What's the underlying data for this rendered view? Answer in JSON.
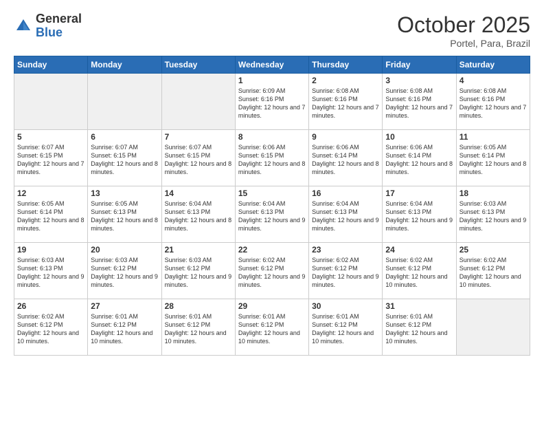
{
  "logo": {
    "general": "General",
    "blue": "Blue"
  },
  "title": "October 2025",
  "subtitle": "Portel, Para, Brazil",
  "days_header": [
    "Sunday",
    "Monday",
    "Tuesday",
    "Wednesday",
    "Thursday",
    "Friday",
    "Saturday"
  ],
  "weeks": [
    [
      {
        "day": "",
        "info": ""
      },
      {
        "day": "",
        "info": ""
      },
      {
        "day": "",
        "info": ""
      },
      {
        "day": "1",
        "info": "Sunrise: 6:09 AM\nSunset: 6:16 PM\nDaylight: 12 hours\nand 7 minutes."
      },
      {
        "day": "2",
        "info": "Sunrise: 6:08 AM\nSunset: 6:16 PM\nDaylight: 12 hours\nand 7 minutes."
      },
      {
        "day": "3",
        "info": "Sunrise: 6:08 AM\nSunset: 6:16 PM\nDaylight: 12 hours\nand 7 minutes."
      },
      {
        "day": "4",
        "info": "Sunrise: 6:08 AM\nSunset: 6:16 PM\nDaylight: 12 hours\nand 7 minutes."
      }
    ],
    [
      {
        "day": "5",
        "info": "Sunrise: 6:07 AM\nSunset: 6:15 PM\nDaylight: 12 hours\nand 7 minutes."
      },
      {
        "day": "6",
        "info": "Sunrise: 6:07 AM\nSunset: 6:15 PM\nDaylight: 12 hours\nand 8 minutes."
      },
      {
        "day": "7",
        "info": "Sunrise: 6:07 AM\nSunset: 6:15 PM\nDaylight: 12 hours\nand 8 minutes."
      },
      {
        "day": "8",
        "info": "Sunrise: 6:06 AM\nSunset: 6:15 PM\nDaylight: 12 hours\nand 8 minutes."
      },
      {
        "day": "9",
        "info": "Sunrise: 6:06 AM\nSunset: 6:14 PM\nDaylight: 12 hours\nand 8 minutes."
      },
      {
        "day": "10",
        "info": "Sunrise: 6:06 AM\nSunset: 6:14 PM\nDaylight: 12 hours\nand 8 minutes."
      },
      {
        "day": "11",
        "info": "Sunrise: 6:05 AM\nSunset: 6:14 PM\nDaylight: 12 hours\nand 8 minutes."
      }
    ],
    [
      {
        "day": "12",
        "info": "Sunrise: 6:05 AM\nSunset: 6:14 PM\nDaylight: 12 hours\nand 8 minutes."
      },
      {
        "day": "13",
        "info": "Sunrise: 6:05 AM\nSunset: 6:13 PM\nDaylight: 12 hours\nand 8 minutes."
      },
      {
        "day": "14",
        "info": "Sunrise: 6:04 AM\nSunset: 6:13 PM\nDaylight: 12 hours\nand 8 minutes."
      },
      {
        "day": "15",
        "info": "Sunrise: 6:04 AM\nSunset: 6:13 PM\nDaylight: 12 hours\nand 9 minutes."
      },
      {
        "day": "16",
        "info": "Sunrise: 6:04 AM\nSunset: 6:13 PM\nDaylight: 12 hours\nand 9 minutes."
      },
      {
        "day": "17",
        "info": "Sunrise: 6:04 AM\nSunset: 6:13 PM\nDaylight: 12 hours\nand 9 minutes."
      },
      {
        "day": "18",
        "info": "Sunrise: 6:03 AM\nSunset: 6:13 PM\nDaylight: 12 hours\nand 9 minutes."
      }
    ],
    [
      {
        "day": "19",
        "info": "Sunrise: 6:03 AM\nSunset: 6:13 PM\nDaylight: 12 hours\nand 9 minutes."
      },
      {
        "day": "20",
        "info": "Sunrise: 6:03 AM\nSunset: 6:12 PM\nDaylight: 12 hours\nand 9 minutes."
      },
      {
        "day": "21",
        "info": "Sunrise: 6:03 AM\nSunset: 6:12 PM\nDaylight: 12 hours\nand 9 minutes."
      },
      {
        "day": "22",
        "info": "Sunrise: 6:02 AM\nSunset: 6:12 PM\nDaylight: 12 hours\nand 9 minutes."
      },
      {
        "day": "23",
        "info": "Sunrise: 6:02 AM\nSunset: 6:12 PM\nDaylight: 12 hours\nand 9 minutes."
      },
      {
        "day": "24",
        "info": "Sunrise: 6:02 AM\nSunset: 6:12 PM\nDaylight: 12 hours\nand 10 minutes."
      },
      {
        "day": "25",
        "info": "Sunrise: 6:02 AM\nSunset: 6:12 PM\nDaylight: 12 hours\nand 10 minutes."
      }
    ],
    [
      {
        "day": "26",
        "info": "Sunrise: 6:02 AM\nSunset: 6:12 PM\nDaylight: 12 hours\nand 10 minutes."
      },
      {
        "day": "27",
        "info": "Sunrise: 6:01 AM\nSunset: 6:12 PM\nDaylight: 12 hours\nand 10 minutes."
      },
      {
        "day": "28",
        "info": "Sunrise: 6:01 AM\nSunset: 6:12 PM\nDaylight: 12 hours\nand 10 minutes."
      },
      {
        "day": "29",
        "info": "Sunrise: 6:01 AM\nSunset: 6:12 PM\nDaylight: 12 hours\nand 10 minutes."
      },
      {
        "day": "30",
        "info": "Sunrise: 6:01 AM\nSunset: 6:12 PM\nDaylight: 12 hours\nand 10 minutes."
      },
      {
        "day": "31",
        "info": "Sunrise: 6:01 AM\nSunset: 6:12 PM\nDaylight: 12 hours\nand 10 minutes."
      },
      {
        "day": "",
        "info": ""
      }
    ]
  ]
}
